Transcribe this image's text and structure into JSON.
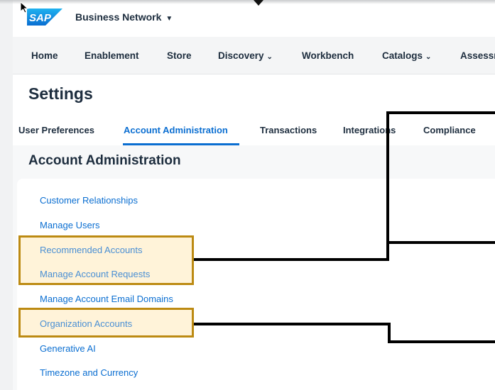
{
  "topbar": {
    "logo_text": "SAP",
    "app_title": "Business Network",
    "app_caret": "▼"
  },
  "nav": {
    "items": [
      {
        "label": "Home",
        "caret": ""
      },
      {
        "label": "Enablement",
        "caret": ""
      },
      {
        "label": "Store",
        "caret": ""
      },
      {
        "label": "Discovery",
        "caret": "⌄"
      },
      {
        "label": "Workbench",
        "caret": ""
      },
      {
        "label": "Catalogs",
        "caret": "⌄"
      },
      {
        "label": "Assessm",
        "caret": ""
      }
    ]
  },
  "settings": {
    "title": "Settings",
    "tabs": [
      {
        "label": "User Preferences",
        "active": false
      },
      {
        "label": "Account Administration",
        "active": true
      },
      {
        "label": "Transactions",
        "active": false
      },
      {
        "label": "Integrations",
        "active": false
      },
      {
        "label": "Compliance",
        "active": false
      }
    ]
  },
  "section": {
    "title": "Account Administration",
    "links": [
      "Customer Relationships",
      "Manage Users",
      "Recommended Accounts",
      "Manage Account Requests",
      "Manage Account Email Domains",
      "Organization Accounts",
      "Generative AI",
      "Timezone and Currency"
    ]
  },
  "colors": {
    "link": "#0a6ed1",
    "highlight_border": "#bc8a12",
    "sap_blue": "#0a6ed1"
  },
  "icons": [
    "cursor-icon",
    "down-arrow-icon",
    "sap-logo"
  ]
}
